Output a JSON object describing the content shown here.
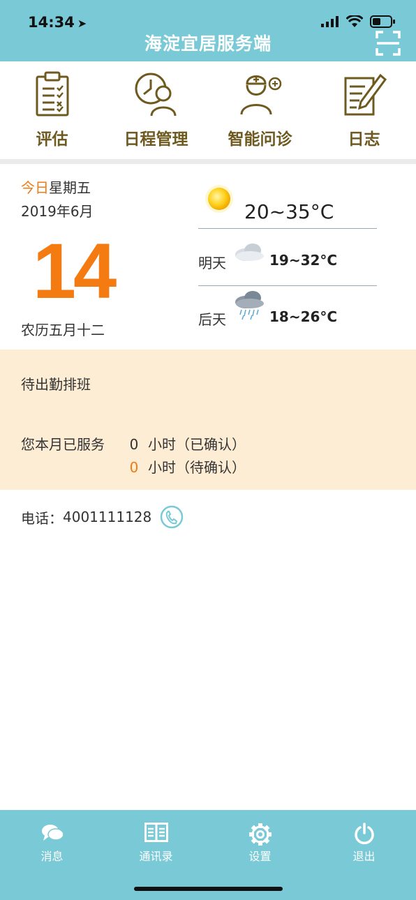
{
  "status_bar": {
    "time": "14:34"
  },
  "header": {
    "title": "海淀宜居服务端"
  },
  "menu": {
    "items": [
      {
        "label": "评估",
        "icon": "clipboard-checklist-icon"
      },
      {
        "label": "日程管理",
        "icon": "clock-person-icon"
      },
      {
        "label": "智能问诊",
        "icon": "doctor-consult-icon"
      },
      {
        "label": "日志",
        "icon": "notepad-pen-icon"
      }
    ]
  },
  "date": {
    "today_prefix": "今日",
    "weekday": "星期五",
    "year_month": "2019年6月",
    "day": "14",
    "lunar": "农历五月十二"
  },
  "weather": {
    "today": {
      "temp": "20~35°C",
      "icon": "sun-icon"
    },
    "tomorrow": {
      "label": "明天",
      "temp": "19~32°C",
      "icon": "cloudy-icon"
    },
    "day_after": {
      "label": "后天",
      "temp": "18~26°C",
      "icon": "rain-cloud-icon"
    }
  },
  "duty": {
    "title": "待出勤排班",
    "served_label": "您本月已服务",
    "confirmed_hours": "0",
    "confirmed_label": "小时（已确认）",
    "pending_hours": "0",
    "pending_label": "小时（待确认）"
  },
  "contact": {
    "phone_label": "电话：",
    "phone_number": "4001111128"
  },
  "tabbar": {
    "items": [
      {
        "label": "消息",
        "icon": "chat-bubble-icon"
      },
      {
        "label": "通讯录",
        "icon": "contacts-book-icon"
      },
      {
        "label": "设置",
        "icon": "gear-icon"
      },
      {
        "label": "退出",
        "icon": "power-icon"
      }
    ]
  },
  "colors": {
    "primary": "#79c9d6",
    "accent": "#f47b12",
    "menu_text": "#6e5a1f",
    "duty_bg": "#feedd5"
  }
}
